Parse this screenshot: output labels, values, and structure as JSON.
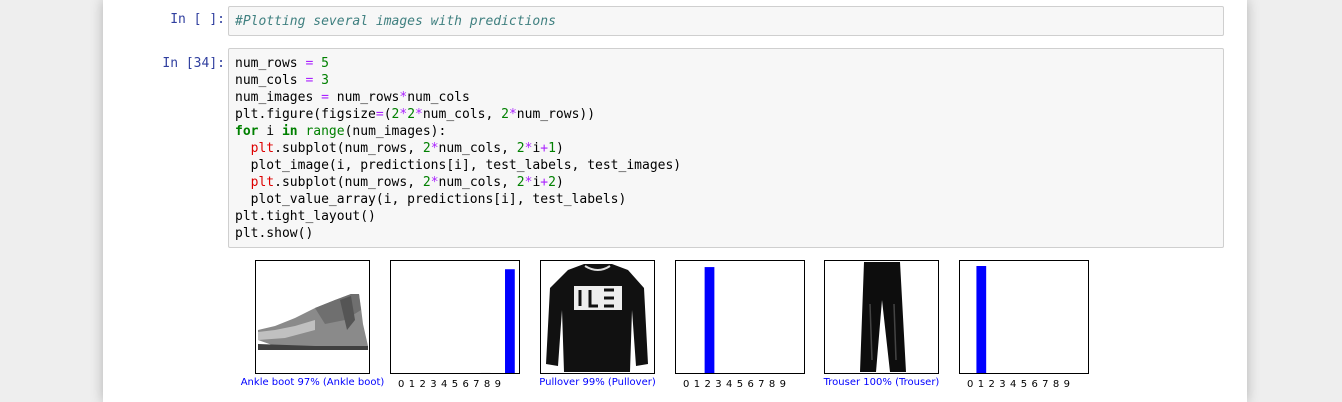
{
  "cell1": {
    "prompt": "In [ ]:",
    "code": "#Plotting several images with predictions"
  },
  "cell2": {
    "prompt": "In [34]:",
    "lines": [
      [
        {
          "t": "num_rows "
        },
        {
          "t": "=",
          "c": "op"
        },
        {
          "t": " "
        },
        {
          "t": "5",
          "c": "num"
        }
      ],
      [
        {
          "t": "num_cols "
        },
        {
          "t": "=",
          "c": "op"
        },
        {
          "t": " "
        },
        {
          "t": "3",
          "c": "num"
        }
      ],
      [
        {
          "t": "num_images "
        },
        {
          "t": "=",
          "c": "op"
        },
        {
          "t": " num_rows"
        },
        {
          "t": "*",
          "c": "op"
        },
        {
          "t": "num_cols"
        }
      ],
      [
        {
          "t": "plt"
        },
        {
          "t": "."
        },
        {
          "t": "figure(figsize"
        },
        {
          "t": "=",
          "c": "op"
        },
        {
          "t": "("
        },
        {
          "t": "2",
          "c": "num"
        },
        {
          "t": "*",
          "c": "op"
        },
        {
          "t": "2",
          "c": "num"
        },
        {
          "t": "*",
          "c": "op"
        },
        {
          "t": "num_cols, "
        },
        {
          "t": "2",
          "c": "num"
        },
        {
          "t": "*",
          "c": "op"
        },
        {
          "t": "num_rows))"
        }
      ],
      [
        {
          "t": "for",
          "c": "kw"
        },
        {
          "t": " i "
        },
        {
          "t": "in",
          "c": "kw"
        },
        {
          "t": " "
        },
        {
          "t": "range",
          "c": "num"
        },
        {
          "t": "(num_images):"
        }
      ],
      [
        {
          "t": "  "
        },
        {
          "t": "plt",
          "c": "red"
        },
        {
          "t": ".subplot(num_rows, "
        },
        {
          "t": "2",
          "c": "num"
        },
        {
          "t": "*",
          "c": "op"
        },
        {
          "t": "num_cols, "
        },
        {
          "t": "2",
          "c": "num"
        },
        {
          "t": "*",
          "c": "op"
        },
        {
          "t": "i"
        },
        {
          "t": "+",
          "c": "op"
        },
        {
          "t": "1",
          "c": "num"
        },
        {
          "t": ")"
        }
      ],
      [
        {
          "t": "  plot_image(i, predictions[i], test_labels, test_images)"
        }
      ],
      [
        {
          "t": "  "
        },
        {
          "t": "plt",
          "c": "red"
        },
        {
          "t": ".subplot(num_rows, "
        },
        {
          "t": "2",
          "c": "num"
        },
        {
          "t": "*",
          "c": "op"
        },
        {
          "t": "num_cols, "
        },
        {
          "t": "2",
          "c": "num"
        },
        {
          "t": "*",
          "c": "op"
        },
        {
          "t": "i"
        },
        {
          "t": "+",
          "c": "op"
        },
        {
          "t": "2",
          "c": "num"
        },
        {
          "t": ")"
        }
      ],
      [
        {
          "t": "  plot_value_array(i, predictions[i], test_labels)"
        }
      ],
      [
        {
          "t": "plt.tight_layout()"
        }
      ],
      [
        {
          "t": "plt.show()"
        }
      ]
    ]
  },
  "output": {
    "colors": {
      "bar": "#0000ff",
      "caption": "#0000ff",
      "gray_bar": "#777777"
    },
    "ticks": "0 1 2 3 4 5 6 7 8 9",
    "panels": [
      {
        "caption": "Ankle boot 97% (Ankle boot)",
        "image": "ankle-boot",
        "bars": [
          0,
          0,
          0,
          0,
          0,
          0,
          0,
          0.01,
          0,
          0.97
        ],
        "pred_index": 9
      },
      {
        "caption": "Pullover 99% (Pullover)",
        "image": "pullover",
        "bars": [
          0,
          0,
          0.99,
          0,
          0,
          0,
          0,
          0,
          0,
          0
        ],
        "pred_index": 2
      },
      {
        "caption": "Trouser 100% (Trouser)",
        "image": "trouser",
        "bars": [
          0,
          1.0,
          0,
          0,
          0,
          0,
          0,
          0,
          0,
          0
        ],
        "pred_index": 1
      }
    ]
  }
}
